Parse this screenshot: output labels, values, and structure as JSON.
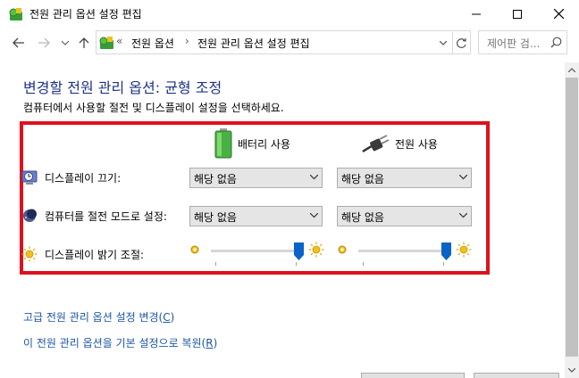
{
  "window": {
    "title": "전원 관리 옵션 설정 편집",
    "controls": {
      "minimize": "minimize",
      "maximize": "maximize",
      "close": "close"
    }
  },
  "address_bar": {
    "overflow": "«",
    "crumbs": [
      "전원 옵션",
      "전원 관리 옵션 설정 편집"
    ],
    "separator": "›"
  },
  "search": {
    "placeholder": "제어판 검..."
  },
  "main": {
    "heading": "변경할 전원 관리 옵션: 균형 조정",
    "subtext": "컴퓨터에서 사용할 절전 및 디스플레이 설정을 선택하세요.",
    "columns": {
      "battery": "배터리 사용",
      "plugged": "전원 사용"
    },
    "rows": {
      "display_off": {
        "label": "디스플레이 끄기:",
        "battery": "해당 없음",
        "plugged": "해당 없음"
      },
      "sleep": {
        "label": "컴퓨터를 절전 모드로 설정:",
        "battery": "해당 없음",
        "plugged": "해당 없음"
      },
      "brightness": {
        "label": "디스플레이 밝기 조절:",
        "battery_level": 1.0,
        "plugged_level": 1.0
      }
    },
    "links": {
      "advanced": {
        "text": "고급 전원 관리 옵션 설정 변경(",
        "key": "C",
        "end": ")"
      },
      "restore": {
        "text": "이 전원 관리 옵션을 기본 설정으로 복원(",
        "key": "R",
        "end": ")"
      }
    }
  },
  "colors": {
    "heading": "#1e3287",
    "link": "#1c57a5",
    "highlight_box": "#e0101e",
    "slider_thumb": "#0a64c8"
  }
}
